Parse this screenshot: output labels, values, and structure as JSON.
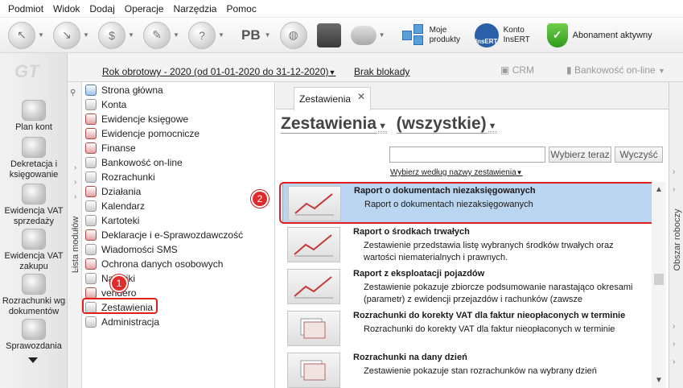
{
  "menubar": [
    "Podmiot",
    "Widok",
    "Dodaj",
    "Operacje",
    "Narzędzia",
    "Pomoc"
  ],
  "toolbar": {
    "pb_label": "PB",
    "moje_produkty": "Moje produkty",
    "konto_insert": "Konto InsERT",
    "insert_logo": "InsERT",
    "abonament": "Abonament aktywny"
  },
  "logo": "GT",
  "leftbar": [
    {
      "label": "Plan kont",
      "icon": "plan-kont-icon"
    },
    {
      "label": "Dekretacja i księgowanie",
      "icon": "dekretacja-icon"
    },
    {
      "label": "Ewidencja VAT sprzedaży",
      "icon": "vat-sprzedazy-icon"
    },
    {
      "label": "Ewidencja VAT zakupu",
      "icon": "vat-zakupu-icon"
    },
    {
      "label": "Rozrachunki wg dokumentów",
      "icon": "rozrachunki-icon"
    },
    {
      "label": "Sprawozdania",
      "icon": "sprawozdania-icon"
    }
  ],
  "yearbar": {
    "rok": "Rok obrotowy - 2020  (od 01-01-2020 do 31-12-2020)",
    "blokady": "Brak blokady",
    "crm": "CRM",
    "bank": "Bankowość on-line"
  },
  "modules_label": "Lista modułów",
  "modules": [
    "Strona główna",
    "Konta",
    "Ewidencje księgowe",
    "Ewidencje pomocnicze",
    "Finanse",
    "Bankowość on-line",
    "Rozrachunki",
    "Działania",
    "Kalendarz",
    "Kartoteki",
    "Deklaracje i e-Sprawozdawczość",
    "Wiadomości SMS",
    "Ochrona danych osobowych",
    "Naklejki",
    "vendero",
    "Zestawienia",
    "Administracja"
  ],
  "badges": {
    "one": "1",
    "two": "2"
  },
  "main": {
    "tab": "Zestawienia",
    "title": "Zestawienia",
    "subtitle": "(wszystkie)",
    "btn_wybierz": "Wybierz teraz",
    "btn_wyczysc": "Wyczyść",
    "filter": "Wybierz według nazwy zestawienia",
    "rows": [
      {
        "title": "Raport o dokumentach niezaksięgowanych",
        "desc": "Raport o dokumentach niezaksięgowanych"
      },
      {
        "title": "Raport o środkach trwałych",
        "desc": "Zestawienie przedstawia listę wybranych środków trwałych oraz wartości niematerialnych i prawnych."
      },
      {
        "title": "Raport z eksploatacji pojazdów",
        "desc": "Zestawienie pokazuje zbiorcze podsumowanie narastająco okresami (parametr) z ewidencji przejazdów i rachunków (zawsze"
      },
      {
        "title": "Rozrachunki do korekty VAT dla faktur nieopłaconych w terminie",
        "desc": "Rozrachunki do korekty VAT dla faktur nieopłaconych w terminie"
      },
      {
        "title": "Rozrachunki na dany dzień",
        "desc": "Zestawienie pokazuje stan rozrachunków na wybrany dzień"
      }
    ]
  },
  "right_label": "Obszar roboczy"
}
